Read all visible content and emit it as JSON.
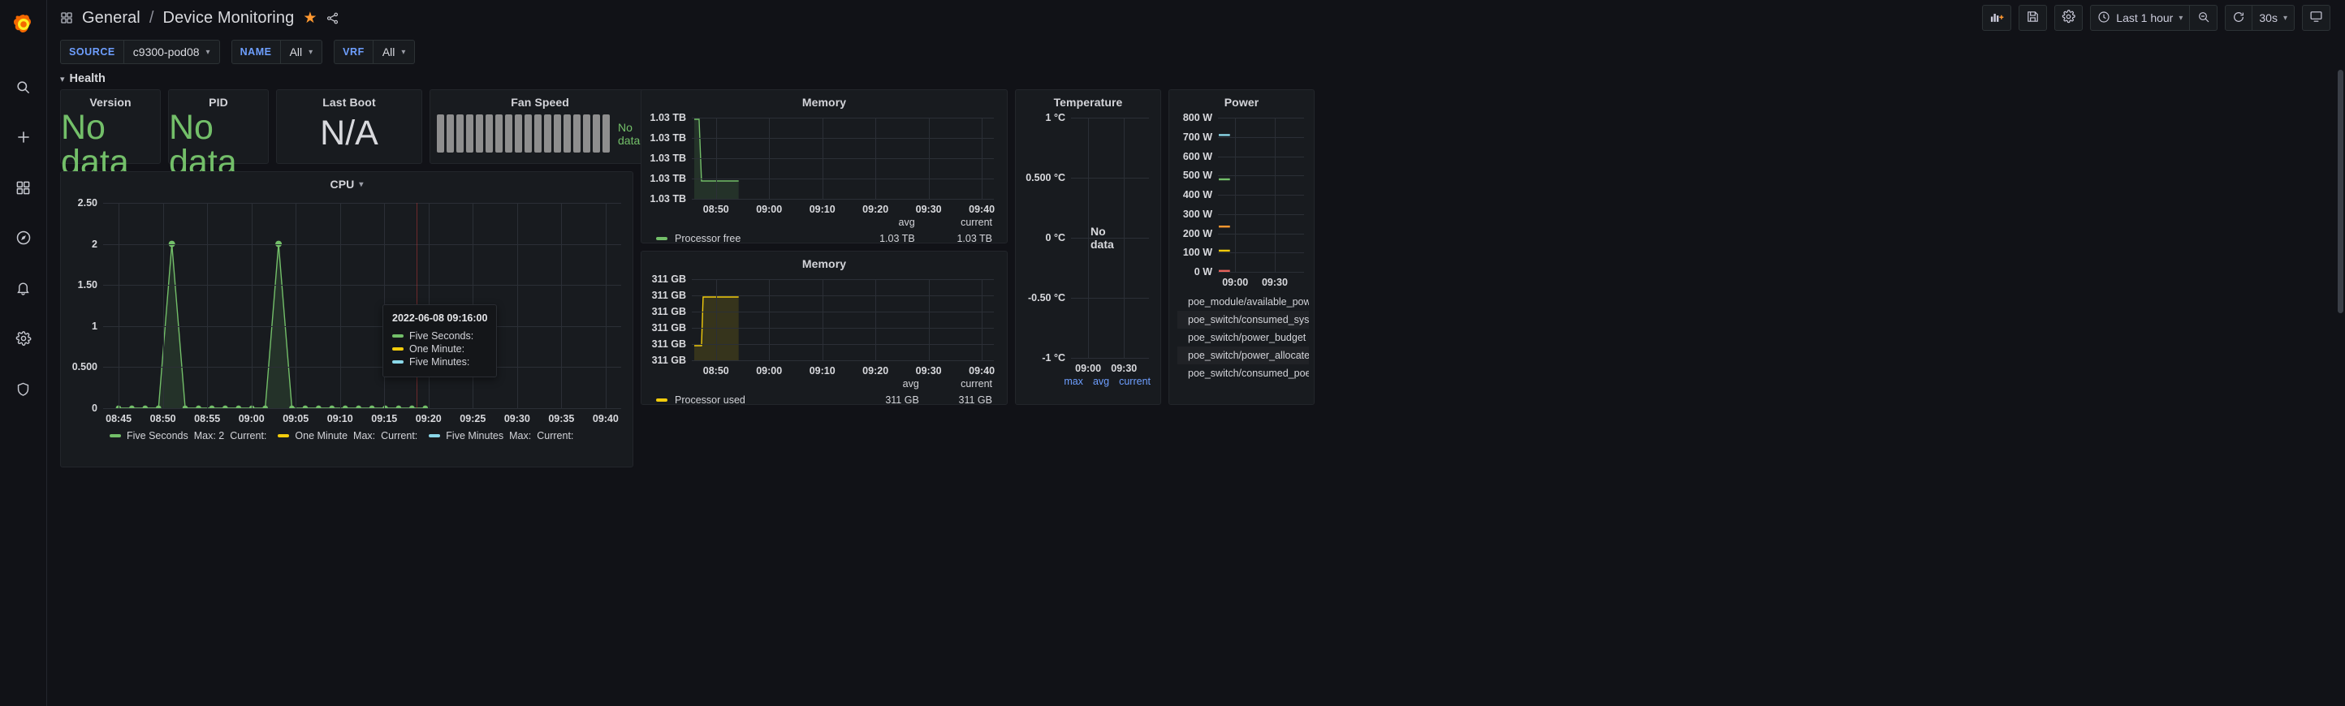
{
  "brand": {
    "logo": "grafana-logo"
  },
  "sidebar": {
    "items": [
      {
        "name": "search",
        "icon": "search-icon"
      },
      {
        "name": "create",
        "icon": "plus-icon"
      },
      {
        "name": "dashboards",
        "icon": "grid-icon"
      },
      {
        "name": "explore",
        "icon": "compass-icon"
      },
      {
        "name": "alerting",
        "icon": "bell-icon"
      },
      {
        "name": "configuration",
        "icon": "gear-icon"
      },
      {
        "name": "server-admin",
        "icon": "shield-icon"
      }
    ]
  },
  "header": {
    "folder": "General",
    "separator": "/",
    "title": "Device Monitoring",
    "star_icon": "star-icon",
    "share_icon": "share-icon",
    "toolbar": {
      "add_panel": "add-panel-icon",
      "save": "save-icon",
      "settings": "gear-icon",
      "time_range": "Last 1 hour",
      "time_icon": "clock-icon",
      "zoom_out": "zoom-out-icon",
      "refresh": "refresh-icon",
      "refresh_interval": "30s",
      "tv_mode": "tv-icon"
    }
  },
  "variables": [
    {
      "label": "SOURCE",
      "value": "c9300-pod08"
    },
    {
      "label": "NAME",
      "value": "All"
    },
    {
      "label": "VRF",
      "value": "All"
    }
  ],
  "row": {
    "title": "Health",
    "collapsed": false
  },
  "stats": [
    {
      "title": "Version",
      "value": "No data",
      "color": "#73bf69"
    },
    {
      "title": "PID",
      "value": "No data",
      "color": "#73bf69"
    },
    {
      "title": "Last Boot",
      "value": "N/A",
      "color": "#d8d9dd"
    }
  ],
  "fan": {
    "title": "Fan Speed",
    "bars": 18,
    "no_data": "No data",
    "bar_color": "#8e8e8e"
  },
  "tooltip": {
    "time": "2022-06-08 09:16:00",
    "rows": [
      {
        "label": "Five Seconds:",
        "color": "#73bf69"
      },
      {
        "label": "One Minute:",
        "color": "#f2cc0c"
      },
      {
        "label": "Five Minutes:",
        "color": "#8ad7e8"
      }
    ]
  },
  "chart_data": [
    {
      "id": "cpu",
      "type": "line",
      "title": "CPU",
      "ylabel": "",
      "xlabel": "",
      "yticks": [
        "2.50",
        "2",
        "1.50",
        "1",
        "0.500",
        "0"
      ],
      "yvalues": [
        2.5,
        2,
        1.5,
        1,
        0.5,
        0
      ],
      "ylim": [
        0,
        2.5
      ],
      "xticks": [
        "08:45",
        "08:50",
        "08:55",
        "09:00",
        "09:05",
        "09:10",
        "09:15",
        "09:20",
        "09:25",
        "09:30",
        "09:35",
        "09:40"
      ],
      "grid": true,
      "legend_position": "bottom",
      "series": [
        {
          "name": "Five Seconds",
          "color": "#73bf69",
          "max_label": "Max:",
          "max": "2",
          "current_label": "Current:",
          "current": "",
          "points": [
            0,
            0,
            0,
            0,
            2,
            0,
            0,
            0,
            0,
            0,
            0,
            0,
            2,
            0,
            0,
            0,
            0,
            0,
            0,
            0,
            0,
            0,
            0,
            0
          ]
        },
        {
          "name": "One Minute",
          "color": "#f2cc0c",
          "max_label": "Max:",
          "max": "",
          "current_label": "Current:",
          "current": "",
          "points": []
        },
        {
          "name": "Five Minutes",
          "color": "#8ad7e8",
          "max_label": "Max:",
          "max": "",
          "current_label": "Current:",
          "current": "",
          "points": []
        }
      ]
    },
    {
      "id": "memory-free",
      "type": "area",
      "title": "Memory",
      "yticks": [
        "1.03 TB",
        "1.03 TB",
        "1.03 TB",
        "1.03 TB",
        "1.03 TB"
      ],
      "xticks": [
        "08:50",
        "09:00",
        "09:10",
        "09:20",
        "09:30",
        "09:40"
      ],
      "grid": true,
      "legend_position": "bottom",
      "legend_headers": [
        "avg",
        "current"
      ],
      "series": [
        {
          "name": "Processor free",
          "color": "#73bf69",
          "avg": "1.03 TB",
          "current": "1.03 TB"
        }
      ]
    },
    {
      "id": "memory-used",
      "type": "area",
      "title": "Memory",
      "yticks": [
        "311 GB",
        "311 GB",
        "311 GB",
        "311 GB",
        "311 GB",
        "311 GB"
      ],
      "xticks": [
        "08:50",
        "09:00",
        "09:10",
        "09:20",
        "09:30",
        "09:40"
      ],
      "grid": true,
      "legend_position": "bottom",
      "legend_headers": [
        "avg",
        "current"
      ],
      "series": [
        {
          "name": "Processor used",
          "color": "#f2cc0c",
          "avg": "311 GB",
          "current": "311 GB"
        }
      ]
    },
    {
      "id": "temperature",
      "type": "line",
      "title": "Temperature",
      "yticks": [
        "1 °C",
        "0.500 °C",
        "0 °C",
        "-0.50 °C",
        "-1 °C"
      ],
      "yvalues": [
        1,
        0.5,
        0,
        -0.5,
        -1
      ],
      "ylim": [
        -1,
        1
      ],
      "xticks": [
        "09:00",
        "09:30"
      ],
      "no_data": "No data",
      "grid": true,
      "legend_headers": [
        "max",
        "avg",
        "current"
      ],
      "series": []
    },
    {
      "id": "power",
      "type": "line",
      "title": "Power",
      "yticks": [
        "800 W",
        "700 W",
        "600 W",
        "500 W",
        "400 W",
        "300 W",
        "200 W",
        "100 W",
        "0 W"
      ],
      "yvalues": [
        800,
        700,
        600,
        500,
        400,
        300,
        200,
        100,
        0
      ],
      "ylim": [
        0,
        800
      ],
      "xticks": [
        "09:00",
        "09:30"
      ],
      "grid": true,
      "legend_position": "bottom",
      "legend_headers": [
        "max",
        "avg",
        "current"
      ],
      "series": [
        {
          "name": "poe_module/available_power",
          "color": "#73bf69",
          "value": 480
        },
        {
          "name": "poe_switch/consumed_system_power",
          "color": "#f2cc0c",
          "value": 110
        },
        {
          "name": "poe_switch/power_budget",
          "color": "#8ad7e8",
          "value": 710
        },
        {
          "name": "poe_switch/power_allocated",
          "color": "#ff9830",
          "value": 235
        },
        {
          "name": "poe_switch/consumed_poe_power",
          "color": "#e5625b",
          "value": 5
        }
      ]
    }
  ]
}
